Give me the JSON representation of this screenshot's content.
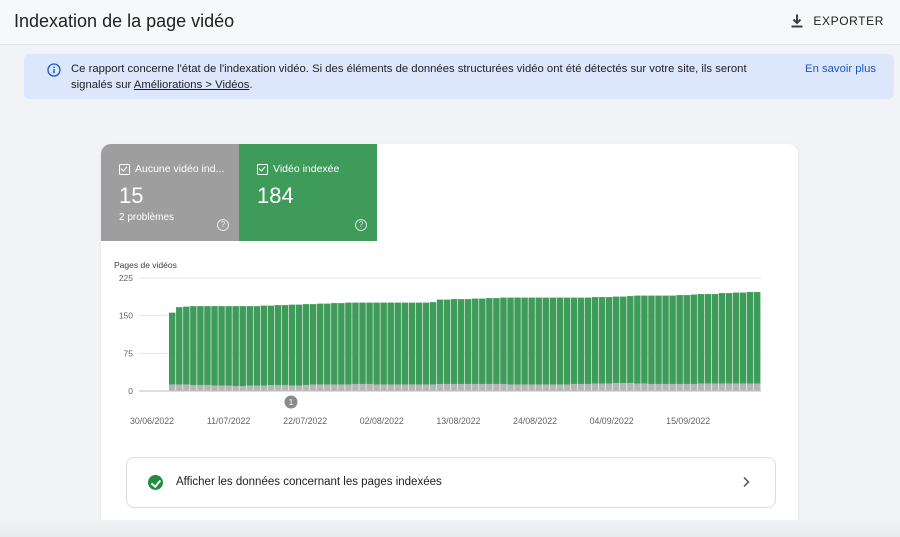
{
  "header": {
    "title": "Indexation de la page vidéo",
    "export_label": "EXPORTER"
  },
  "banner": {
    "text_before": "Ce rapport concerne l'état de l'indexation vidéo. Si des éléments de données structurées vidéo ont été détectés sur votre site, ils seront signalés sur ",
    "link": "Améliorations > Vidéos",
    "text_after": ".",
    "learn_more": "En savoir plus",
    "accent_color": "#1a56c7"
  },
  "tiles": [
    {
      "label": "Aucune vidéo ind...",
      "count": "15",
      "sub": "2 problèmes",
      "checked": true,
      "color": "#9e9e9e"
    },
    {
      "label": "Vidéo indexée",
      "count": "184",
      "sub": "",
      "checked": true,
      "color": "#3f9b5a"
    }
  ],
  "chart_data": {
    "type": "bar",
    "ylabel": "Pages de vidéos",
    "ylim": [
      0,
      225
    ],
    "yticks": [
      "225",
      "150",
      "75",
      "0"
    ],
    "xticks": [
      "30/06/2022",
      "11/07/2022",
      "22/07/2022",
      "02/08/2022",
      "13/08/2022",
      "24/08/2022",
      "04/09/2022",
      "15/09/2022"
    ],
    "annotation": "1",
    "series": [
      {
        "name": "Aucune vidéo indexée",
        "color": "#b5b5b5",
        "values": [
          13,
          13,
          13,
          12,
          12,
          12,
          11,
          11,
          11,
          10,
          10,
          11,
          11,
          11,
          12,
          12,
          12,
          11,
          11,
          12,
          13,
          13,
          13,
          13,
          13,
          13,
          14,
          14,
          14,
          13,
          13,
          13,
          13,
          13,
          13,
          13,
          13,
          13,
          14,
          14,
          14,
          14,
          14,
          14,
          14,
          14,
          14,
          14,
          13,
          13,
          13,
          13,
          13,
          13,
          13,
          13,
          13,
          14,
          14,
          14,
          15,
          15,
          15,
          16,
          16,
          16,
          15,
          15,
          14,
          14,
          14,
          14,
          14,
          14,
          14,
          15,
          15,
          15,
          15,
          15,
          15,
          15,
          15,
          15
        ]
      },
      {
        "name": "Vidéo indexée",
        "color": "#3f9b5a",
        "values": [
          143,
          154,
          155,
          157,
          157,
          157,
          158,
          158,
          158,
          159,
          159,
          158,
          158,
          159,
          158,
          159,
          159,
          161,
          161,
          161,
          160,
          161,
          161,
          162,
          162,
          163,
          162,
          162,
          162,
          163,
          163,
          163,
          163,
          163,
          163,
          163,
          163,
          164,
          168,
          168,
          169,
          169,
          169,
          170,
          170,
          171,
          171,
          172,
          173,
          173,
          173,
          173,
          173,
          173,
          173,
          173,
          173,
          172,
          172,
          172,
          172,
          172,
          172,
          172,
          172,
          173,
          175,
          175,
          176,
          176,
          176,
          176,
          177,
          177,
          178,
          178,
          178,
          178,
          180,
          180,
          181,
          181,
          182,
          182
        ]
      }
    ]
  },
  "indexed_link": {
    "label": "Afficher les données concernant les pages indexées"
  }
}
